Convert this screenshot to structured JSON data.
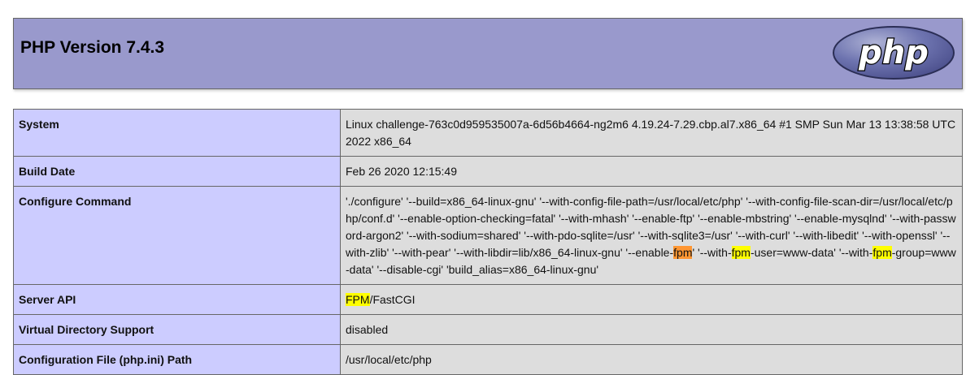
{
  "page": {
    "title": "PHP Version 7.4.3",
    "logo_text": "php"
  },
  "colors": {
    "header_bg": "#9999cc",
    "label_bg": "#ccccff",
    "value_bg": "#dddddd",
    "highlight_yellow": "#ffff00",
    "highlight_orange": "#ff9632"
  },
  "rows": [
    {
      "label": "System",
      "value": "Linux challenge-763c0d959535007a-6d56b4664-ng2m6 4.19.24-7.29.cbp.al7.x86_64 #1 SMP Sun Mar 13 13:38:58 UTC 2022 x86_64"
    },
    {
      "label": "Build Date",
      "value": "Feb 26 2020 12:15:49"
    },
    {
      "label": "Configure Command",
      "segments": [
        "'./configure' '--build=x86_64-linux-gnu' '--with-config-file-path=/usr/local/etc/php' '--with-config-file-scan-dir=/usr/local/etc/php/conf.d' '--enable-option-checking=fatal' '--with-mhash' '--enable-ftp' '--enable-mbstring' '--enable-mysqlnd' '--with-password-argon2' '--with-sodium=shared' '--with-pdo-sqlite=/usr' '--with-sqlite3=/usr' '--with-curl' '--with-libedit' '--with-openssl' '--with-zlib' '--with-pear' '--with-libdir=lib/x86_64-linux-gnu' '--enable-",
        "fpm",
        "' '--with-",
        "fpm",
        "-user=www-data' '--with-",
        "fpm",
        "-group=www-data' '--disable-cgi' 'build_alias=x86_64-linux-gnu'"
      ]
    },
    {
      "label": "Server API",
      "value_hl": "FPM",
      "value_rest": "/FastCGI"
    },
    {
      "label": "Virtual Directory Support",
      "value": "disabled"
    },
    {
      "label": "Configuration File (php.ini) Path",
      "value": "/usr/local/etc/php"
    }
  ]
}
